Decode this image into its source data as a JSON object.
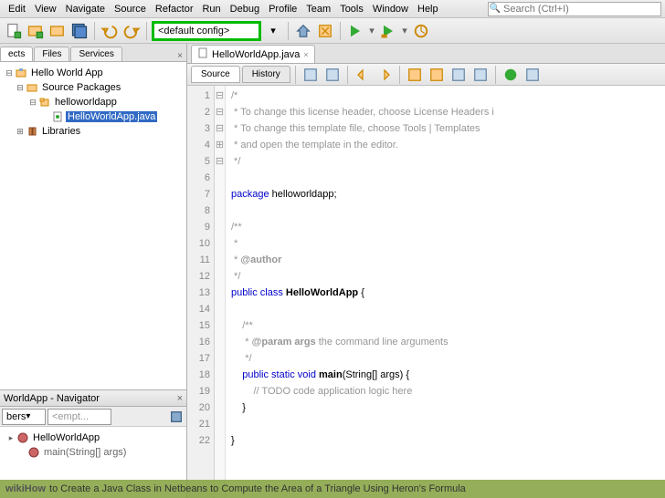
{
  "menu": [
    "Edit",
    "View",
    "Navigate",
    "Source",
    "Refactor",
    "Run",
    "Debug",
    "Profile",
    "Team",
    "Tools",
    "Window",
    "Help"
  ],
  "search": {
    "placeholder": "Search (Ctrl+I)"
  },
  "config": "<default config>",
  "projects": {
    "tabs": [
      "ects",
      "Files",
      "Services"
    ],
    "tree": {
      "root": "Hello World App",
      "pkg_folder": "Source Packages",
      "pkg": "helloworldapp",
      "file": "HelloWorldApp.java",
      "libs": "Libraries"
    }
  },
  "navigator": {
    "title": "WorldApp - Navigator",
    "combo1": "bers",
    "combo2": "<empt...",
    "class": "HelloWorldApp",
    "method": "main(String[] args)"
  },
  "editor": {
    "tab": "HelloWorldApp.java",
    "srcTabs": [
      "Source",
      "History"
    ],
    "lines": [
      "1",
      "2",
      "3",
      "4",
      "5",
      "6",
      "7",
      "8",
      "9",
      "10",
      "11",
      "12",
      "13",
      "14",
      "15",
      "16",
      "17",
      "18",
      "19",
      "20",
      "21",
      "22"
    ],
    "fold": [
      "⊟",
      "",
      "",
      "",
      "",
      "",
      "",
      "",
      "⊟",
      "",
      "",
      "",
      "⊟",
      "",
      "⊞",
      "",
      "",
      "⊟",
      "",
      "",
      "",
      ""
    ],
    "code": {
      "l1": "/*",
      "l2": " * To change this license header, choose License Headers i",
      "l3": " * To change this template file, choose Tools | Templates ",
      "l4": " * and open the template in the editor.",
      "l5": " */",
      "l7a": "package",
      "l7b": " helloworldapp;",
      "l9": "/**",
      "l10": " *",
      "l11a": " * ",
      "l11b": "@author",
      "l12": " */",
      "l13a": "public class ",
      "l13b": "HelloWorldApp",
      "l13c": " {",
      "l15": "    /**",
      "l16a": "     * ",
      "l16b": "@param",
      "l16c": " args",
      "l16d": " the command line arguments",
      "l17": "     */",
      "l18a": "    public static void ",
      "l18b": "main",
      "l18c": "(String[] args) {",
      "l19": "        // TODO code application logic here",
      "l20": "    }",
      "l22": "}"
    }
  },
  "caption": {
    "brand": "wikiHow",
    "text": " to Create a Java Class in Netbeans to Compute the Area of a Triangle Using Heron's Formula"
  }
}
